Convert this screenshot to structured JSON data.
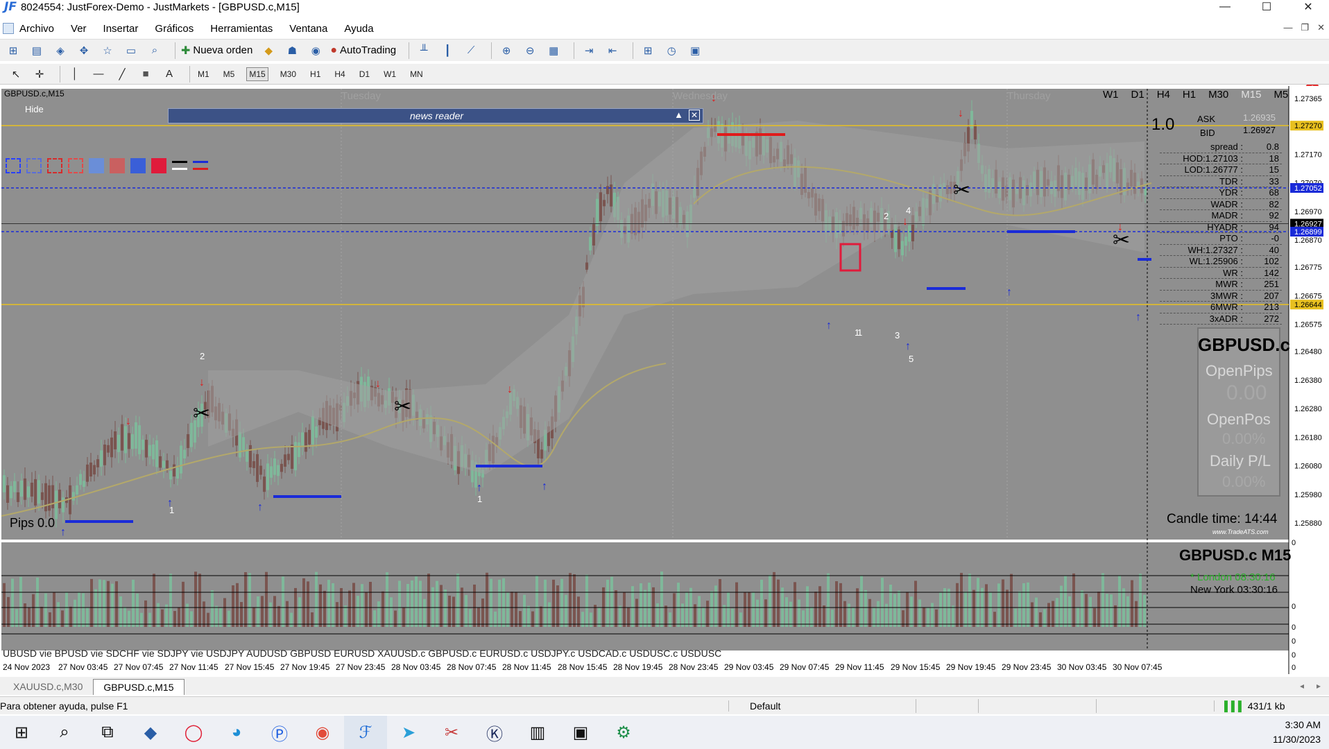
{
  "window": {
    "title": "8024554: JustForex-Demo - JustMarkets - [GBPUSD.c,M15]",
    "logo": "JF"
  },
  "menu": [
    "Archivo",
    "Ver",
    "Insertar",
    "Gráficos",
    "Herramientas",
    "Ventana",
    "Ayuda"
  ],
  "toolbar": {
    "new_order": "Nueva orden",
    "autotrading": "AutoTrading"
  },
  "timeframes": [
    "M1",
    "M5",
    "M15",
    "M30",
    "H1",
    "H4",
    "D1",
    "W1",
    "MN"
  ],
  "active_timeframe": "M15",
  "chart": {
    "symbol_tf": "GBPUSD.c,M15",
    "hide_btn": "Hide",
    "news_reader": "news reader",
    "days": [
      "Tuesday",
      "Wednesday",
      "Thursday"
    ],
    "tf_links": [
      "W1",
      "D1",
      "H4",
      "H1",
      "M30",
      "M15",
      "M5"
    ],
    "prices": [
      "1.27365",
      "1.27270",
      "1.27170",
      "1.27070",
      "1.27052",
      "1.26970",
      "1.26927",
      "1.26899",
      "1.26870",
      "1.26775",
      "1.26675",
      "1.26644",
      "1.26575",
      "1.26480",
      "1.26380",
      "1.26280",
      "1.26180",
      "1.26080",
      "1.25980",
      "1.25880"
    ],
    "pips": "Pips 0.0",
    "big_label": "1.0",
    "ask_label": "ASK",
    "ask_value": "1.26935",
    "bid_label": "BID",
    "bid_value": "1.26927",
    "stats": [
      [
        "spread :",
        "0.8"
      ],
      [
        "HOD:1.27103 :",
        "18"
      ],
      [
        "LOD:1.26777 :",
        "15"
      ],
      [
        "TDR :",
        "33"
      ],
      [
        "YDR :",
        "68"
      ],
      [
        "WADR :",
        "82"
      ],
      [
        "MADR :",
        "92"
      ],
      [
        "HYADR :",
        "94"
      ],
      [
        "PTO :",
        "-0"
      ],
      [
        "WH:1.27327 :",
        "40"
      ],
      [
        "WL:1.25906 :",
        "102"
      ],
      [
        "WR :",
        "142"
      ],
      [
        "MWR :",
        "251"
      ],
      [
        "3MWR :",
        "207"
      ],
      [
        "6MWR :",
        "213"
      ],
      [
        "3xADR :",
        "272"
      ]
    ],
    "panel_symbol": "GBPUSD.c",
    "open_pips_label": "OpenPips",
    "open_pips_value": "0.00",
    "open_pos_label": "OpenPos",
    "open_pos_value": "0.00%",
    "daily_pl_label": "Daily P/L",
    "daily_pl_value": "0.00%",
    "candle_time": "Candle time: 14:44",
    "credit": "www.TradeATS.com",
    "sub_title": "GBPUSD.c  M15",
    "london": "* London   08:30:16",
    "newyork": "New York   03:30:16",
    "pairs_bar": "UBUSD vie  BPUSD vie  SDCHF vie  SDJPY vie   USDJPY    AUDUSD    GBPUSD    EURUSD   XAUUSD.c   GBPUSD.c  EURUSD.c  USDJPY.c  USDCAD.c  USDUSC.c   USDUSC",
    "time_axis": [
      "24 Nov 2023",
      "27 Nov 03:45",
      "27 Nov 07:45",
      "27 Nov 11:45",
      "27 Nov 15:45",
      "27 Nov 19:45",
      "27 Nov 23:45",
      "28 Nov 03:45",
      "28 Nov 07:45",
      "28 Nov 11:45",
      "28 Nov 15:45",
      "28 Nov 19:45",
      "28 Nov 23:45",
      "29 Nov 03:45",
      "29 Nov 07:45",
      "29 Nov 11:45",
      "29 Nov 15:45",
      "29 Nov 19:45",
      "29 Nov 23:45",
      "30 Nov 03:45",
      "30 Nov 07:45"
    ],
    "marks": [
      "2",
      "1",
      "1",
      "1",
      "2",
      "4",
      "3",
      "5",
      "1"
    ]
  },
  "tabs": [
    "XAUUSD.c,M30",
    "GBPUSD.c,M15"
  ],
  "active_tab": "GBPUSD.c,M15",
  "status": {
    "help": "Para obtener ayuda, pulse F1",
    "profile": "Default",
    "traffic": "431/1 kb"
  },
  "clock": {
    "time": "3:30 AM",
    "date": "11/30/2023"
  },
  "notification_count": "1",
  "colors": {
    "chart_bg": "#8f8f8f",
    "bull": "#7fb89a",
    "bear": "#7a5550",
    "gold": "#e8c020",
    "blue_line": "#1a2bd8",
    "red_line": "#e01b1b"
  }
}
